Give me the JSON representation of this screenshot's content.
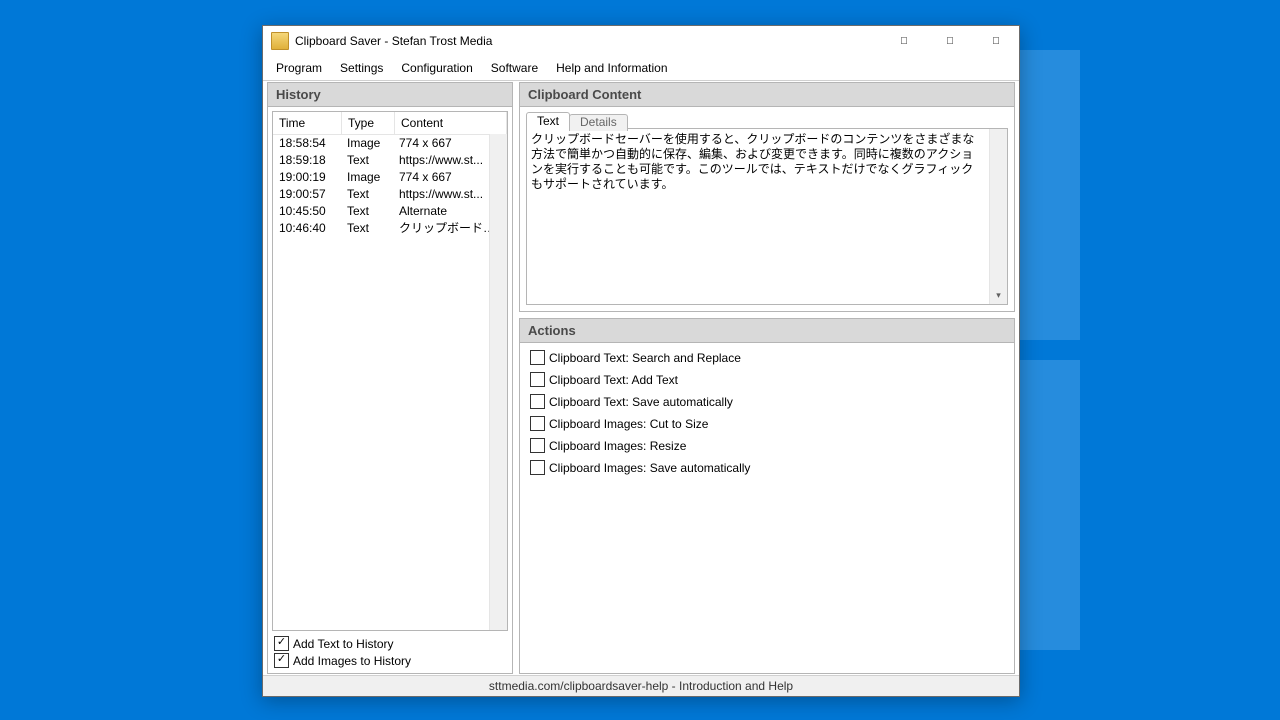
{
  "window": {
    "title": "Clipboard Saver - Stefan Trost Media"
  },
  "menu": {
    "items": [
      "Program",
      "Settings",
      "Configuration",
      "Software",
      "Help and Information"
    ]
  },
  "history": {
    "title": "History",
    "columns": {
      "time": "Time",
      "type": "Type",
      "content": "Content"
    },
    "rows": [
      {
        "time": "18:58:54",
        "type": "Image",
        "content": "774 x 667"
      },
      {
        "time": "18:59:18",
        "type": "Text",
        "content": "https://www.st..."
      },
      {
        "time": "19:00:19",
        "type": "Image",
        "content": "774 x 667"
      },
      {
        "time": "19:00:57",
        "type": "Text",
        "content": "https://www.st..."
      },
      {
        "time": "10:45:50",
        "type": "Text",
        "content": "Alternate"
      },
      {
        "time": "10:46:40",
        "type": "Text",
        "content": "クリップボードセ..."
      }
    ],
    "add_text_label": "Add Text to History",
    "add_images_label": "Add Images to History"
  },
  "clipboard": {
    "title": "Clipboard Content",
    "tab_text": "Text",
    "tab_details": "Details",
    "content": "クリップボードセーバーを使用すると、クリップボードのコンテンツをさまざまな方法で簡単かつ自動的に保存、編集、および変更できます。同時に複数のアクションを実行することも可能です。このツールでは、テキストだけでなくグラフィックもサポートされています。"
  },
  "actions": {
    "title": "Actions",
    "items": [
      "Clipboard Text: Search and Replace",
      "Clipboard Text: Add Text",
      "Clipboard Text: Save automatically",
      "Clipboard Images: Cut to Size",
      "Clipboard Images: Resize",
      "Clipboard Images: Save automatically"
    ]
  },
  "status": "sttmedia.com/clipboardsaver-help - Introduction and Help"
}
